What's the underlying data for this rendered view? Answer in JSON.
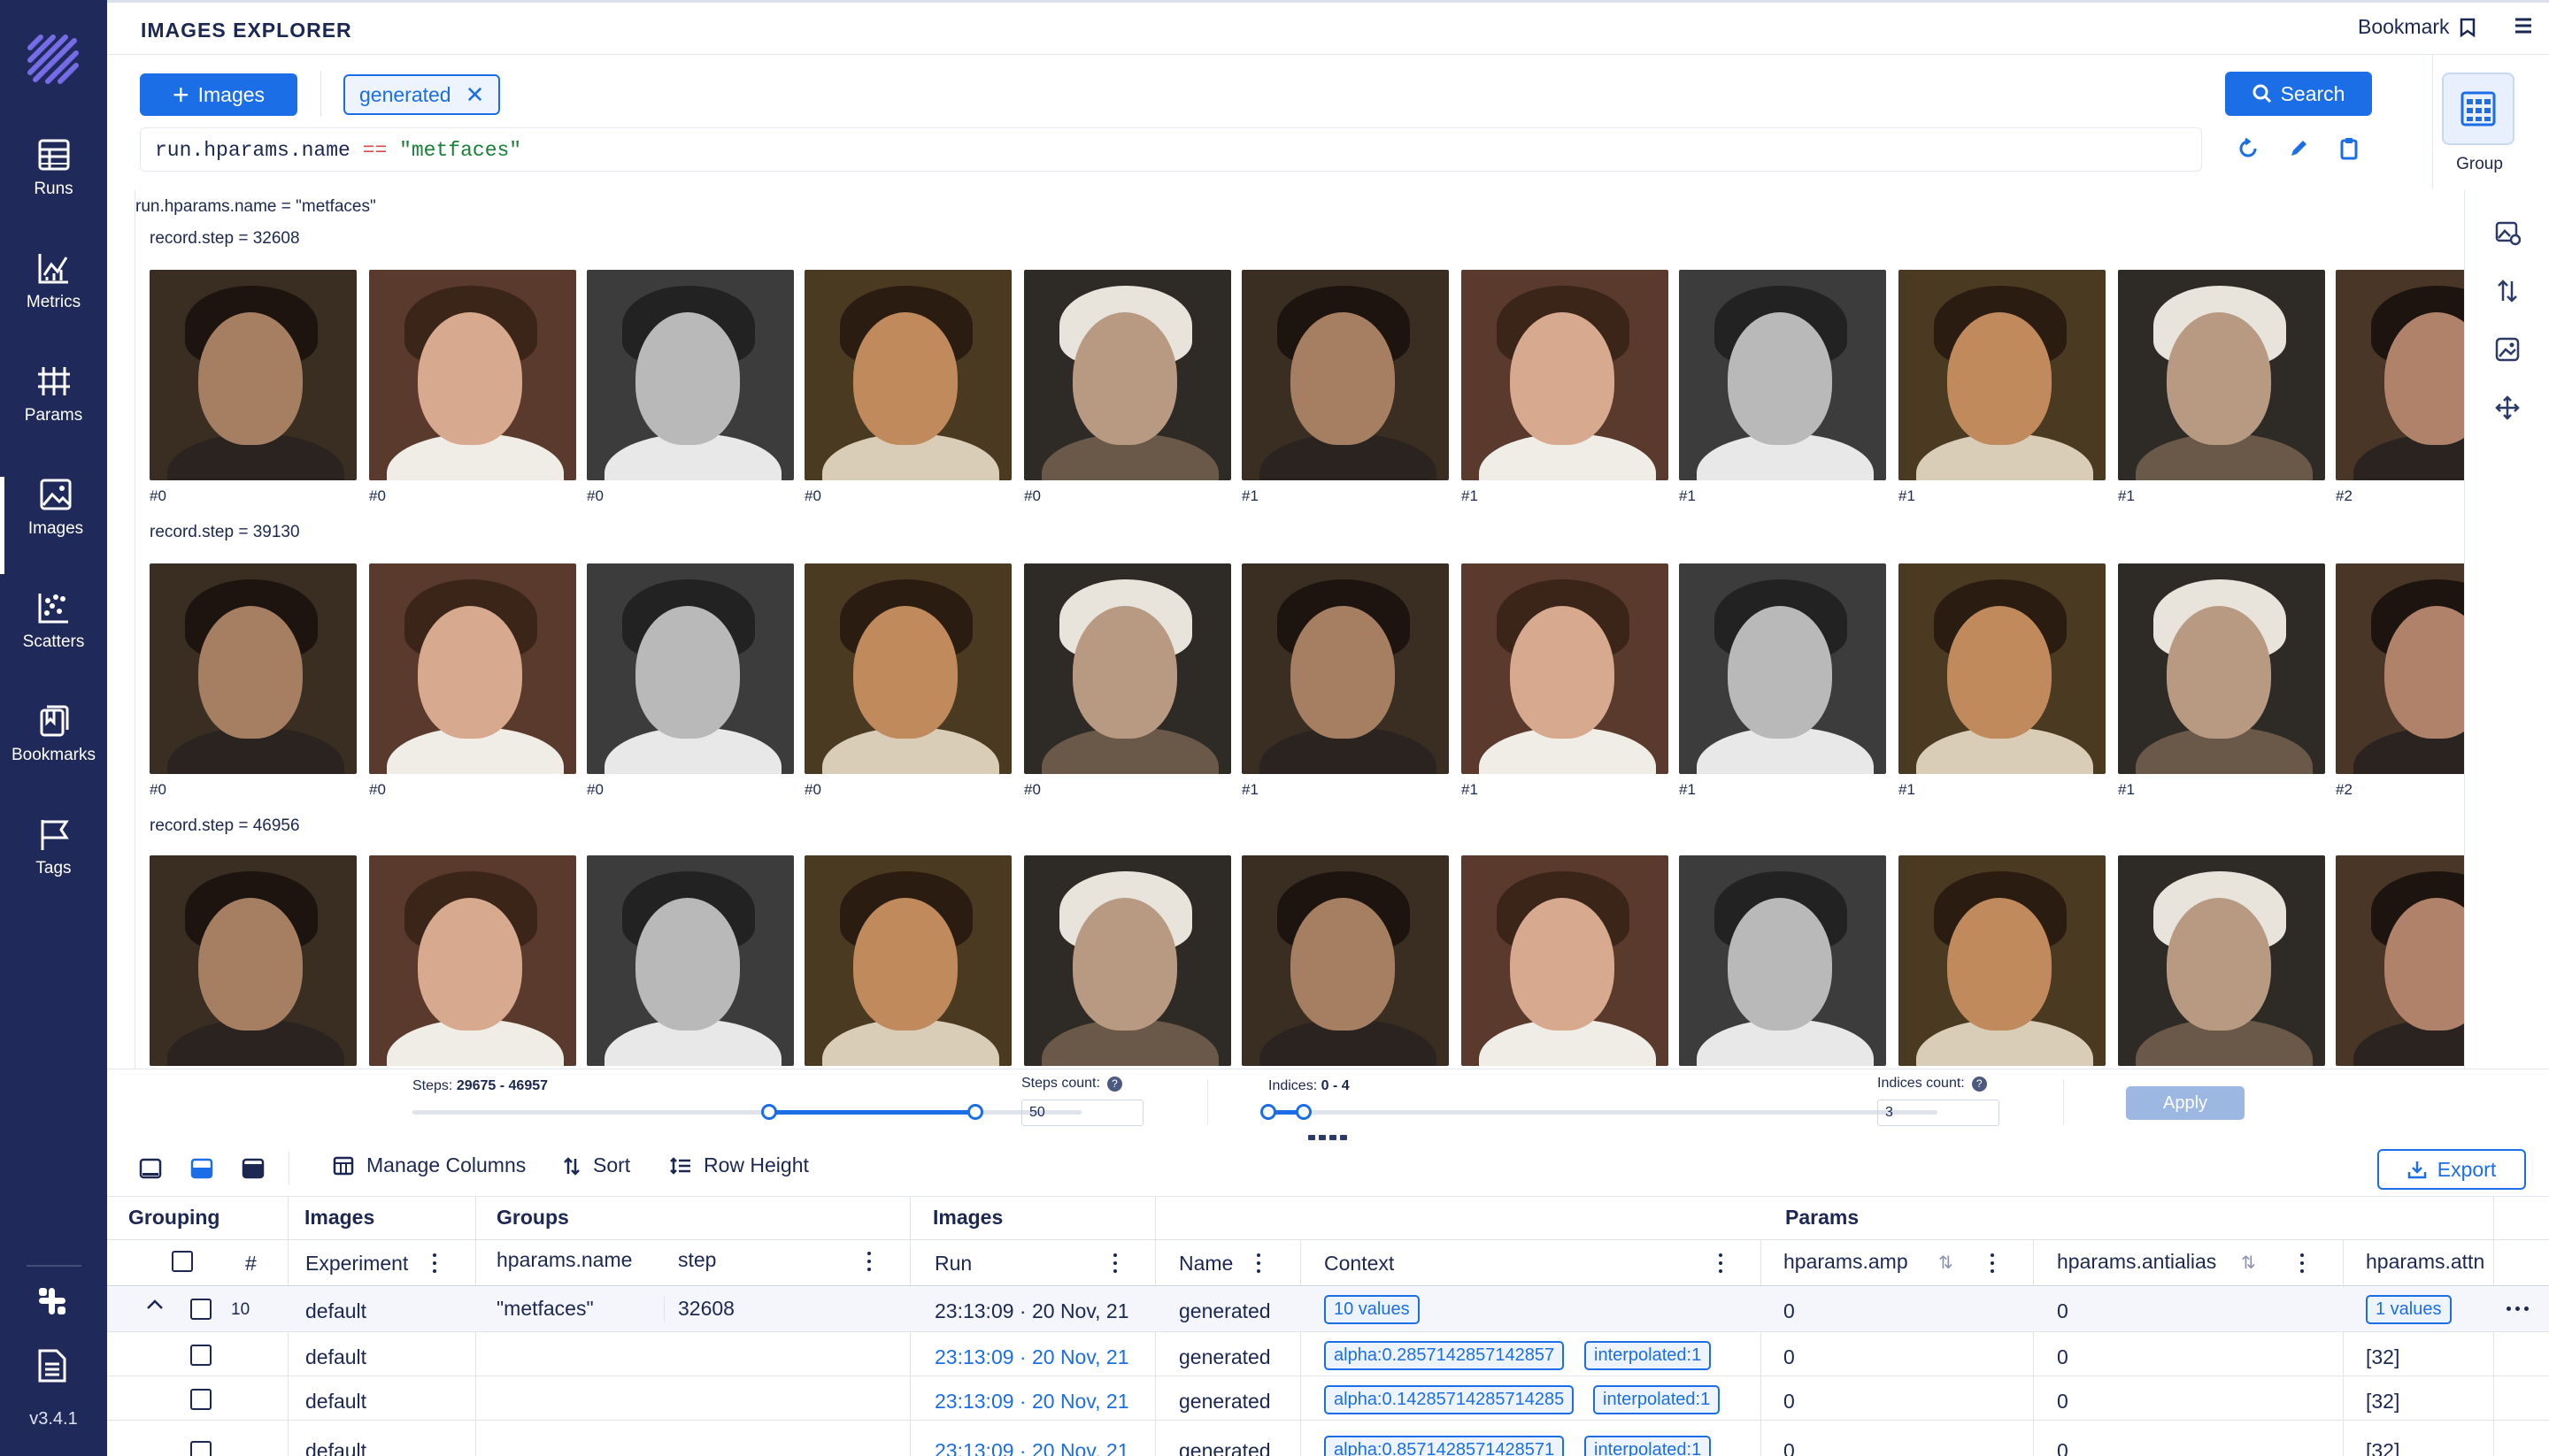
{
  "app": {
    "version": "v3.4.1"
  },
  "sidebar": {
    "items": [
      {
        "label": "Runs",
        "icon": "table-icon"
      },
      {
        "label": "Metrics",
        "icon": "line-chart-icon"
      },
      {
        "label": "Params",
        "icon": "params-icon"
      },
      {
        "label": "Images",
        "icon": "image-icon",
        "active": true
      },
      {
        "label": "Scatters",
        "icon": "scatter-icon"
      },
      {
        "label": "Bookmarks",
        "icon": "bookmark-icon"
      },
      {
        "label": "Tags",
        "icon": "flag-icon"
      }
    ]
  },
  "header": {
    "title": "IMAGES EXPLORER",
    "bookmark_label": "Bookmark"
  },
  "search_bar": {
    "add_button": "Images",
    "chip": "generated",
    "search_button": "Search",
    "query_kw": "run.hparams.name",
    "query_op": "==",
    "query_str": "\"metfaces\"",
    "group_label": "Group"
  },
  "viz": {
    "run_group_title": "run.hparams.name = \"metfaces\"",
    "groups": [
      {
        "title": "record.step = 32608",
        "indices": [
          "#0",
          "#0",
          "#0",
          "#0",
          "#0",
          "#1",
          "#1",
          "#1",
          "#1",
          "#1",
          "#2"
        ]
      },
      {
        "title": "record.step = 39130",
        "indices": [
          "#0",
          "#0",
          "#0",
          "#0",
          "#0",
          "#1",
          "#1",
          "#1",
          "#1",
          "#1",
          "#2"
        ]
      },
      {
        "title": "record.step = 46956",
        "indices": []
      }
    ]
  },
  "controls": {
    "steps_label": "Steps:",
    "steps_range": "29675 - 46957",
    "steps_count_label": "Steps count:",
    "steps_count_value": "50",
    "indices_label": "Indices:",
    "indices_range": "0 - 4",
    "indices_count_label": "Indices count:",
    "indices_count_value": "3",
    "apply_label": "Apply"
  },
  "table_toolbar": {
    "manage_columns": "Manage Columns",
    "sort": "Sort",
    "row_height": "Row Height",
    "export": "Export"
  },
  "table": {
    "group_headers": {
      "grouping": "Grouping",
      "images": "Images",
      "groups": "Groups",
      "images2": "Images",
      "params": "Params"
    },
    "columns": {
      "index": "#",
      "experiment": "Experiment",
      "hparams_name": "hparams.name",
      "step": "step",
      "run": "Run",
      "name": "Name",
      "context": "Context",
      "amp": "hparams.amp",
      "antialias": "hparams.antialias",
      "attn": "hparams.attn"
    },
    "group_row": {
      "count": "10",
      "experiment": "default",
      "hparams_name": "\"metfaces\"",
      "step": "32608",
      "run": "23:13:09 · 20 Nov, 21",
      "name": "generated",
      "context": "10 values",
      "amp": "0",
      "antialias": "0",
      "attn": "1 values"
    },
    "rows": [
      {
        "experiment": "default",
        "run": "23:13:09 · 20 Nov, 21",
        "name": "generated",
        "ctx1": "alpha:0.2857142857142857",
        "ctx2": "interpolated:1",
        "amp": "0",
        "antialias": "0",
        "attn": "[32]"
      },
      {
        "experiment": "default",
        "run": "23:13:09 · 20 Nov, 21",
        "name": "generated",
        "ctx1": "alpha:0.14285714285714285",
        "ctx2": "interpolated:1",
        "amp": "0",
        "antialias": "0",
        "attn": "[32]"
      },
      {
        "experiment": "default",
        "run": "23:13:09 · 20 Nov, 21",
        "name": "generated",
        "ctx1": "alpha:0.8571428571428571",
        "ctx2": "interpolated:1",
        "amp": "0",
        "antialias": "0",
        "attn": "[32]"
      }
    ]
  },
  "colors": {
    "sidebar": "#1f2a5a",
    "accent": "#1b6ee6",
    "text": "#1c2852"
  }
}
